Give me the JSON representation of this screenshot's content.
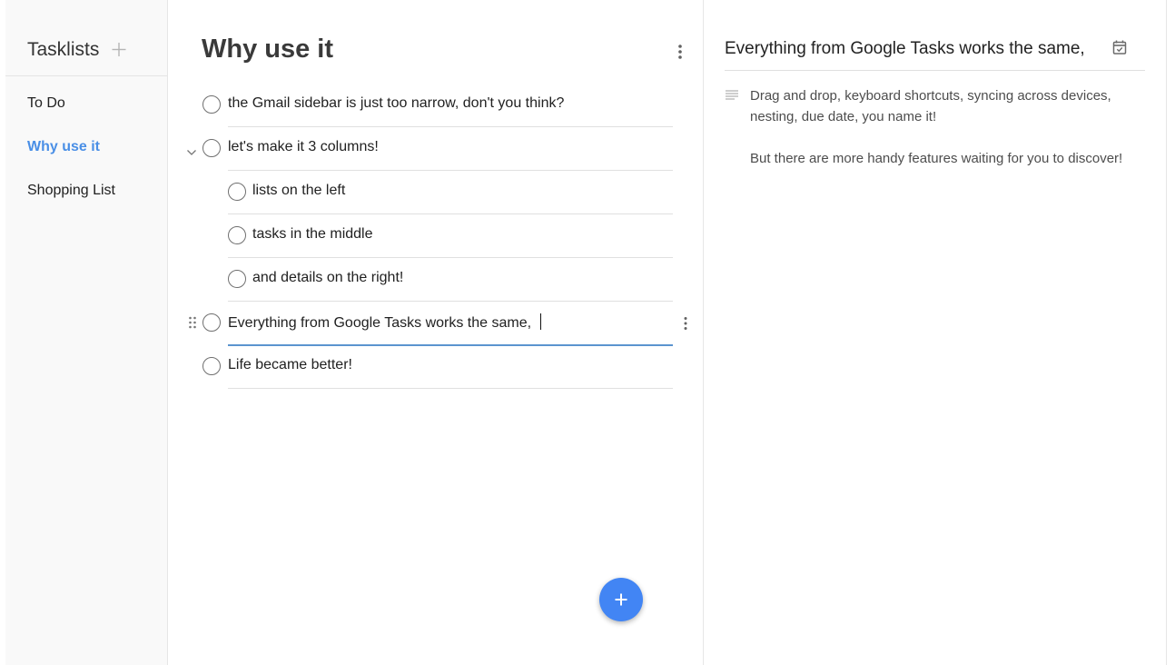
{
  "sidebar": {
    "title": "Tasklists",
    "add_icon": "plus-icon",
    "items": [
      {
        "label": "To Do",
        "active": false
      },
      {
        "label": "Why use it",
        "active": true
      },
      {
        "label": "Shopping List",
        "active": false
      }
    ]
  },
  "main": {
    "title": "Why use it",
    "menu_icon": "more-vert-icon",
    "tasks": [
      {
        "text": "the Gmail sidebar is just too narrow, don't you think?",
        "level": 0
      },
      {
        "text": "let's make it 3 columns!",
        "level": 0,
        "expanded": true
      },
      {
        "text": "lists on the left",
        "level": 1
      },
      {
        "text": "tasks in the middle",
        "level": 1
      },
      {
        "text": "and details on the right!",
        "level": 1
      },
      {
        "text": "Everything from Google Tasks works the same,",
        "level": 0,
        "editing": true
      },
      {
        "text": "Life became better!",
        "level": 0
      }
    ],
    "fab_icon": "plus-icon"
  },
  "details": {
    "title": "Everything from Google Tasks works the same,",
    "date_icon": "calendar-icon",
    "notes_icon": "notes-icon",
    "notes": [
      "Drag and drop, keyboard shortcuts, syncing across devices, nesting, due date, you name it!",
      "But there are more handy features waiting for you to discover!"
    ]
  },
  "colors": {
    "accent": "#4285f4",
    "active_list": "#4a8fe6",
    "edit_underline": "#5b94cf"
  }
}
